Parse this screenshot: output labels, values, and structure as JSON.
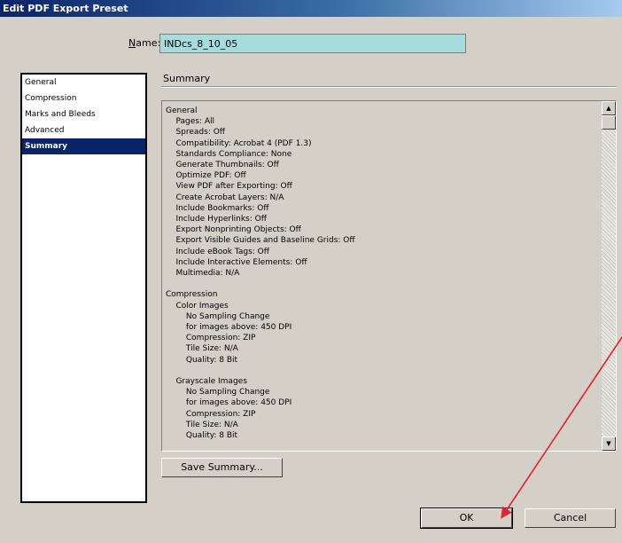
{
  "window": {
    "title": "Edit PDF Export Preset"
  },
  "name_field": {
    "label_prefix": "N",
    "label_rest": "ame:",
    "value": "INDcs_8_10_05"
  },
  "categories": [
    {
      "label": "General",
      "selected": false
    },
    {
      "label": "Compression",
      "selected": false
    },
    {
      "label": "Marks and Bleeds",
      "selected": false
    },
    {
      "label": "Advanced",
      "selected": false
    },
    {
      "label": "Summary",
      "selected": true
    }
  ],
  "panel": {
    "title": "Summary"
  },
  "summary_lines": [
    "General",
    "    Pages: All",
    "    Spreads: Off",
    "    Compatibility: Acrobat 4 (PDF 1.3)",
    "    Standards Compliance: None",
    "    Generate Thumbnails: Off",
    "    Optimize PDF: Off",
    "    View PDF after Exporting: Off",
    "    Create Acrobat Layers: N/A",
    "    Include Bookmarks: Off",
    "    Include Hyperlinks: Off",
    "    Export Nonprinting Objects: Off",
    "    Export Visible Guides and Baseline Grids: Off",
    "    Include eBook Tags: Off",
    "    Include Interactive Elements: Off",
    "    Multimedia: N/A",
    "",
    "Compression",
    "    Color Images",
    "        No Sampling Change",
    "        for images above: 450 DPI",
    "        Compression: ZIP",
    "        Tile Size: N/A",
    "        Quality: 8 Bit",
    "",
    "    Grayscale Images",
    "        No Sampling Change",
    "        for images above: 450 DPI",
    "        Compression: ZIP",
    "        Tile Size: N/A",
    "        Quality: 8 Bit"
  ],
  "buttons": {
    "save_summary": "Save Summary...",
    "ok": "OK",
    "cancel": "Cancel"
  },
  "colors": {
    "dialog_bg": "#d4d0c8",
    "title_bar": "#0a246a",
    "name_field_bg": "#a6dcdc",
    "selection": "#0a246a",
    "annotation_arrow": "#e8202a"
  },
  "icons": {
    "scroll_up": "triangle-up",
    "scroll_down": "triangle-down"
  }
}
